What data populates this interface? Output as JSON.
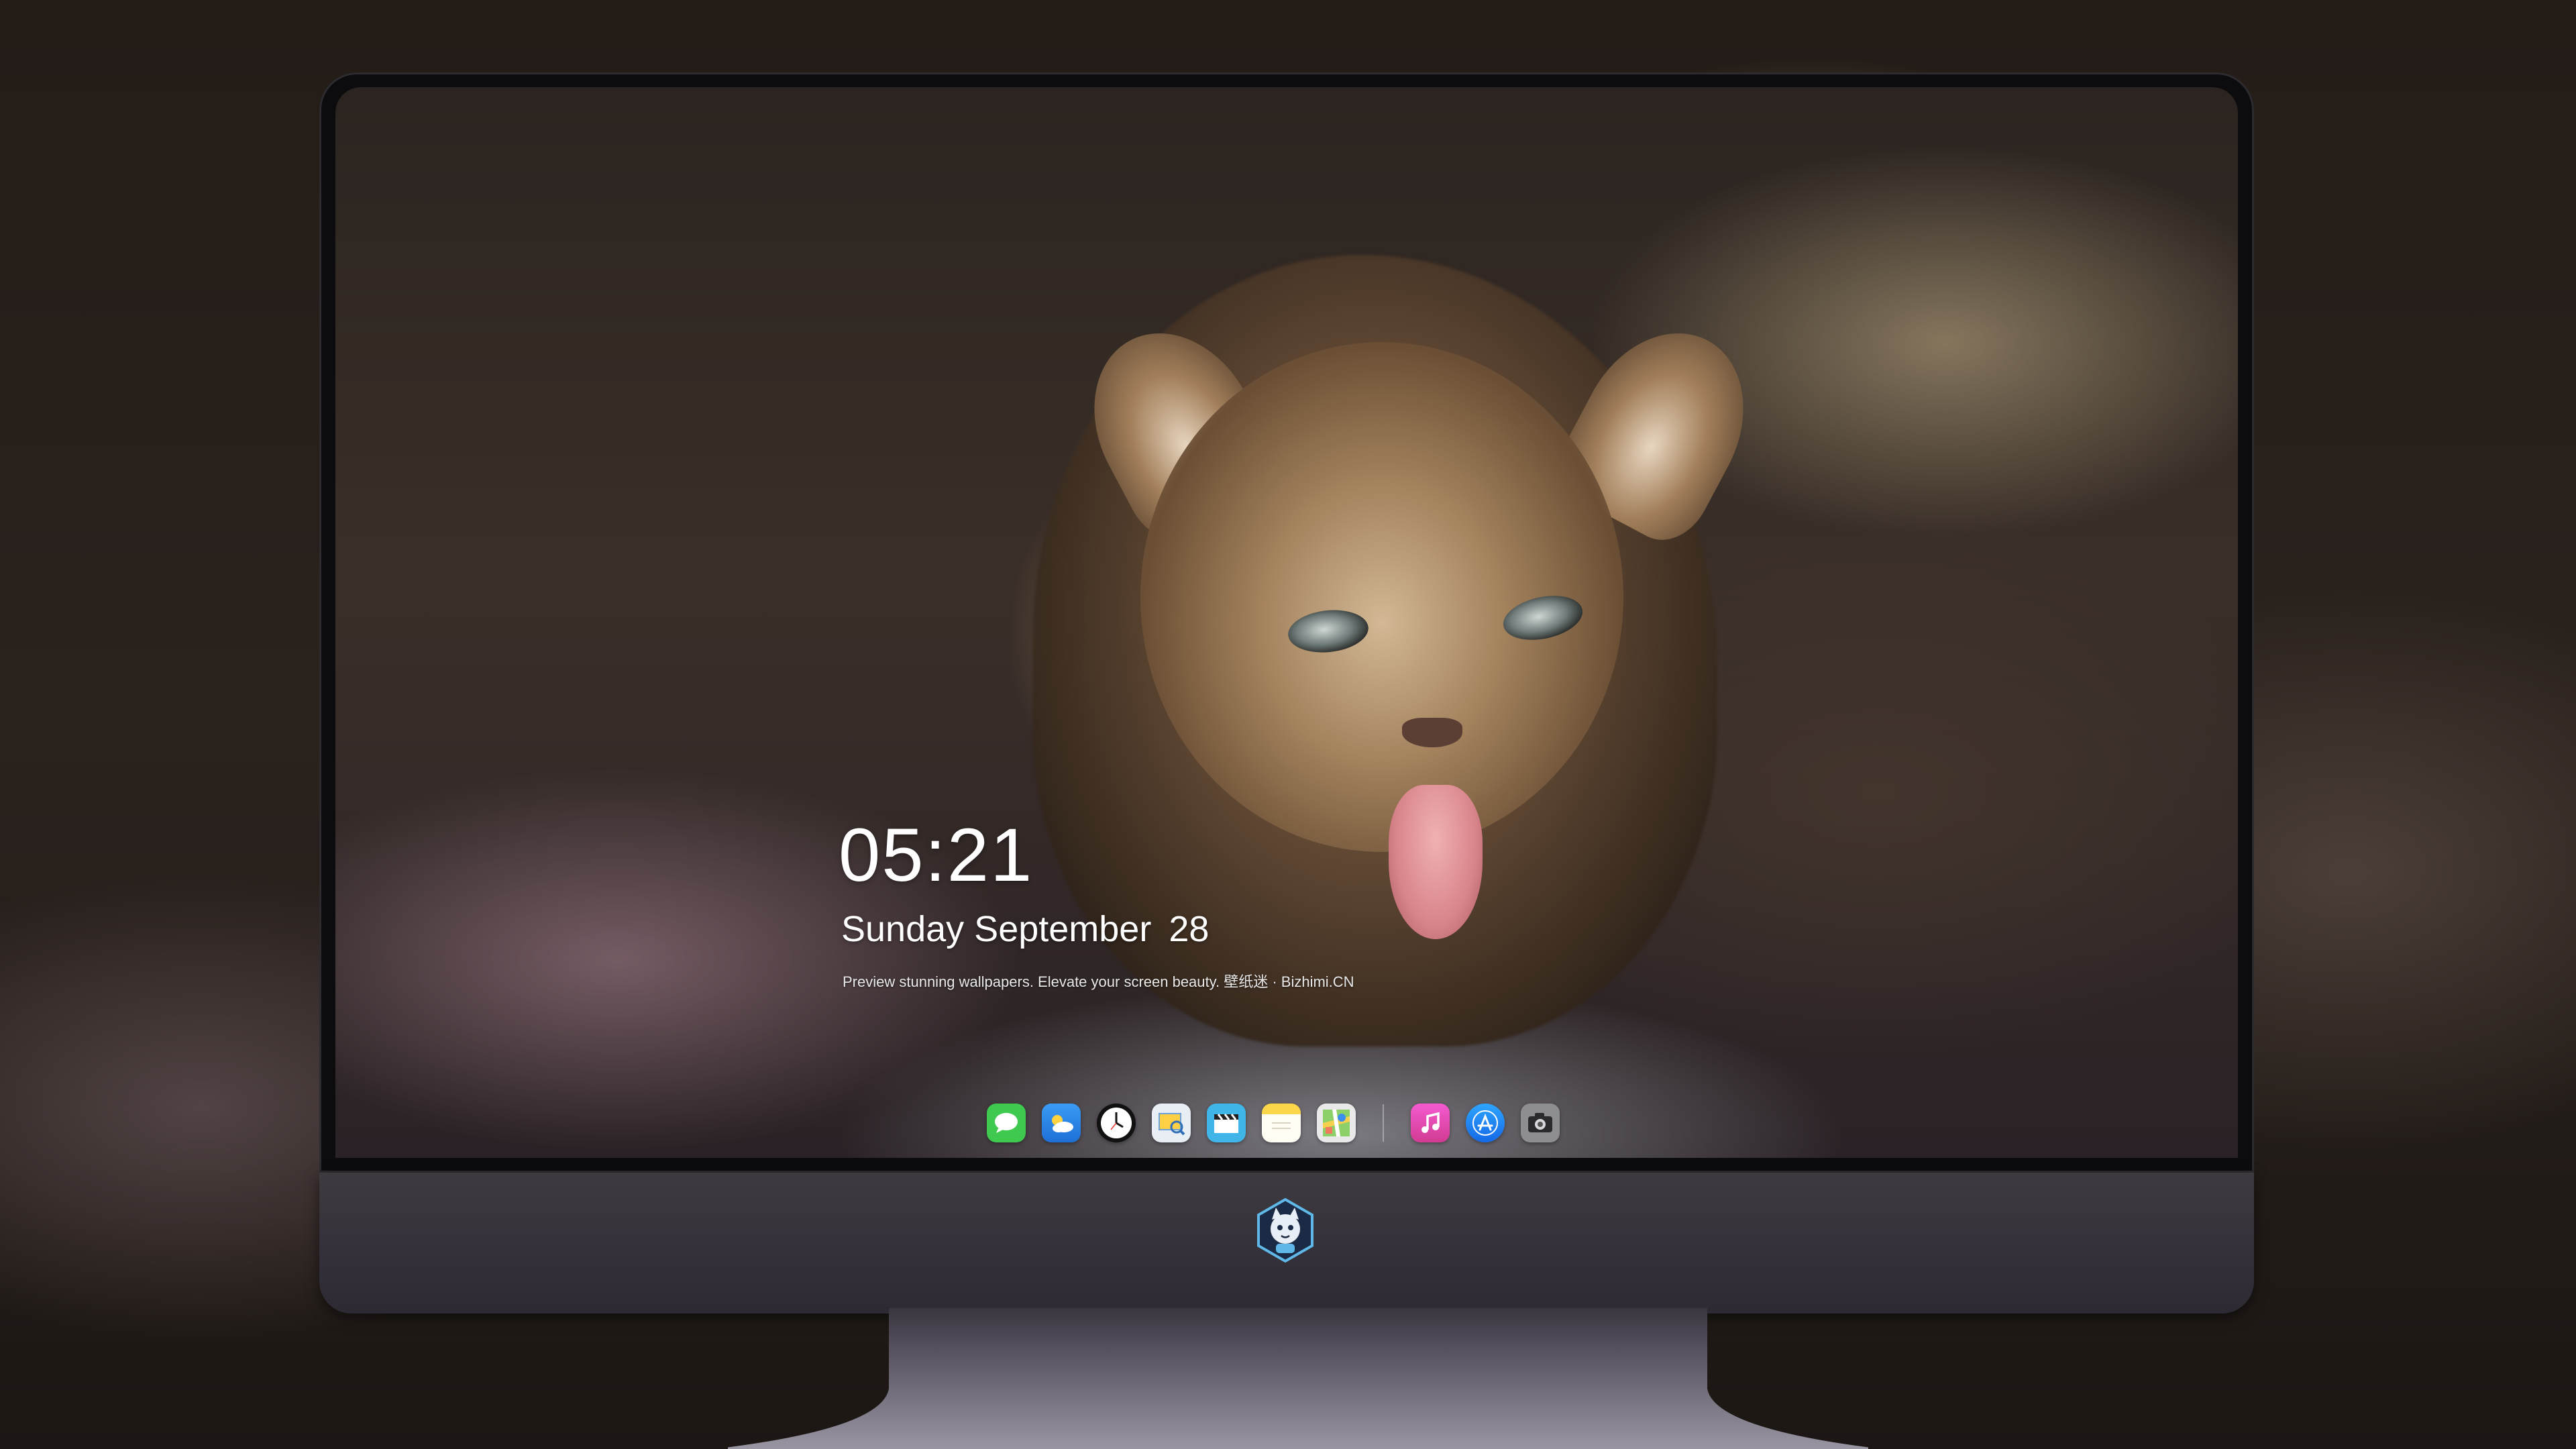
{
  "lockscreen": {
    "time": "05:21",
    "weekday": "Sunday",
    "month": "September",
    "day": "28",
    "tagline": "Preview stunning wallpapers. Elevate your screen beauty. 壁纸迷 · Bizhimi.CN"
  },
  "dock": {
    "items": [
      {
        "name": "messages-icon",
        "color": "#3fc94f"
      },
      {
        "name": "weather-icon",
        "color": "#2f8cf0"
      },
      {
        "name": "clock-icon",
        "color": "#111111"
      },
      {
        "name": "preview-icon",
        "color": "#e9eef4"
      },
      {
        "name": "clips-icon",
        "color": "#3fb5e8"
      },
      {
        "name": "notes-icon",
        "color": "#fbd64a"
      },
      {
        "name": "maps-icon",
        "color": "#e9e9e9"
      },
      {
        "name": "music-icon",
        "color": "#f246b0"
      },
      {
        "name": "app-store-icon",
        "color": "#1f8df5"
      },
      {
        "name": "camera-icon",
        "color": "#8d8d92"
      }
    ]
  },
  "brand": {
    "logo": "bizhimi-cat-logo-icon"
  }
}
